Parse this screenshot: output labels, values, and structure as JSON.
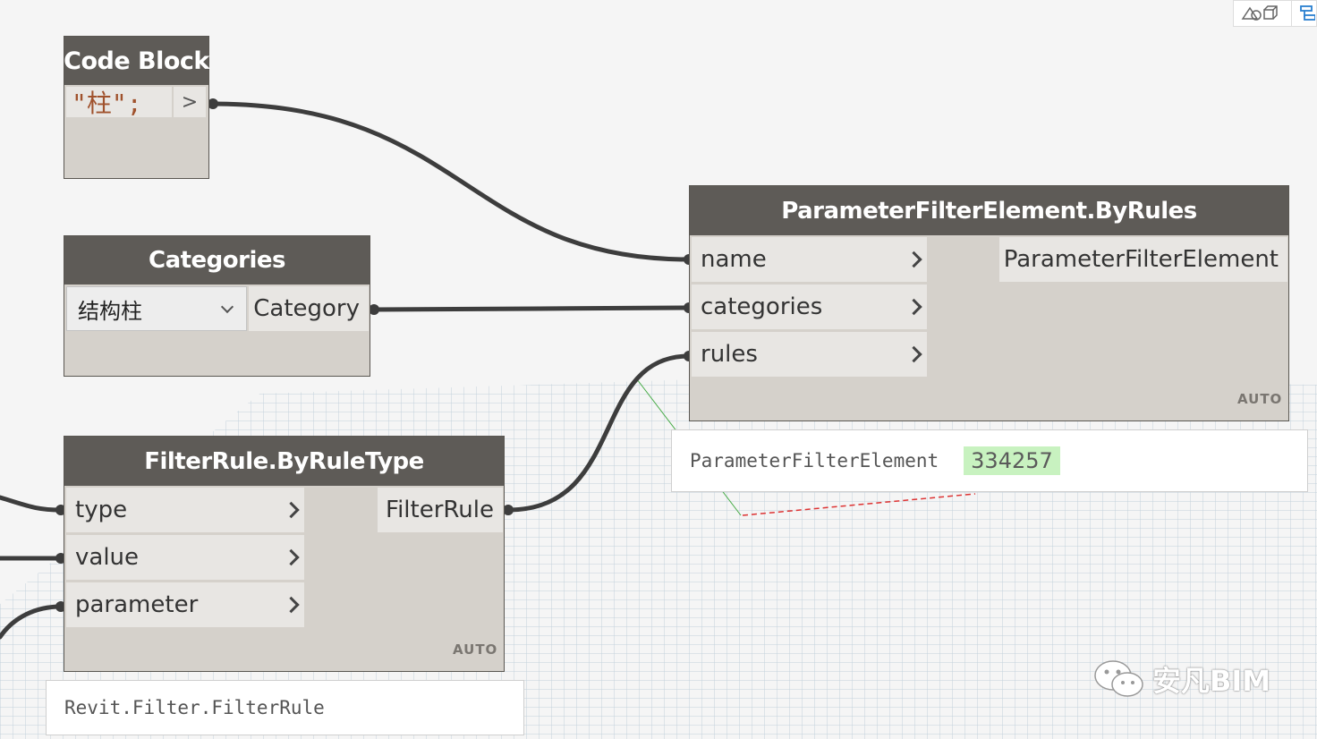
{
  "nodes": {
    "code_block": {
      "title": "Code Block",
      "code": "\"柱\";",
      "output_label": ">"
    },
    "categories": {
      "title": "Categories",
      "dropdown_value": "结构柱",
      "output_label": "Category"
    },
    "filter_rule": {
      "title": "FilterRule.ByRuleType",
      "inputs": [
        "type",
        "value",
        "parameter"
      ],
      "output_label": "FilterRule",
      "lacing": "AUTO",
      "preview": "Revit.Filter.FilterRule"
    },
    "param_filter": {
      "title": "ParameterFilterElement.ByRules",
      "inputs": [
        "name",
        "categories",
        "rules"
      ],
      "output_label": "ParameterFilterElement",
      "lacing": "AUTO",
      "preview_type": "ParameterFilterElement",
      "preview_id": "334257"
    }
  },
  "watermark": "安凡BIM",
  "colors": {
    "node_header": "#5e5b57",
    "node_body": "#d5d1cb",
    "port_bg": "#e8e6e3",
    "wire": "#3d3d3d",
    "id_badge": "#c8f2c0"
  }
}
